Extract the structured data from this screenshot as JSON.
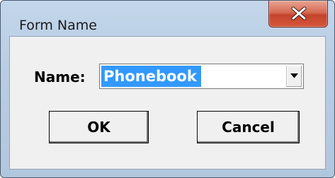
{
  "window": {
    "title": "Form Name"
  },
  "titlebar": {
    "close_glyph": "x",
    "close_icon": "close-icon"
  },
  "form": {
    "name_label": "Name:",
    "name_value": "Phonebook",
    "dropdown_icon": "chevron-down-icon"
  },
  "buttons": {
    "ok_label": "OK",
    "cancel_label": "Cancel"
  },
  "colors": {
    "selection": "#3399ff",
    "close_button": "#c5442c",
    "frame": "#b8cde3"
  }
}
